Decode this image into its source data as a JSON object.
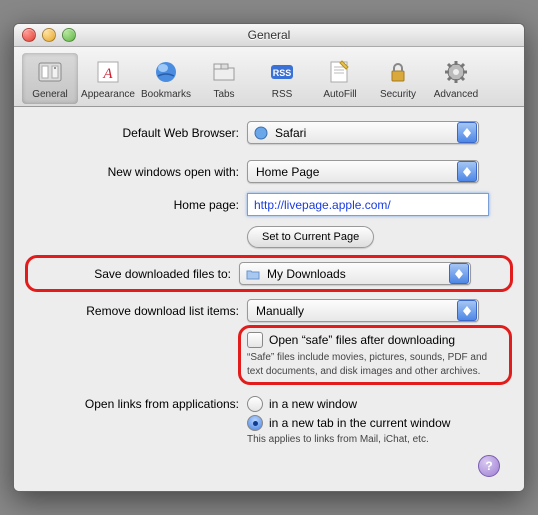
{
  "window_title": "General",
  "toolbar": {
    "items": [
      {
        "label": "General",
        "selected": true
      },
      {
        "label": "Appearance"
      },
      {
        "label": "Bookmarks"
      },
      {
        "label": "Tabs"
      },
      {
        "label": "RSS"
      },
      {
        "label": "AutoFill"
      },
      {
        "label": "Security"
      },
      {
        "label": "Advanced"
      }
    ]
  },
  "labels": {
    "default_browser": "Default Web Browser:",
    "new_windows": "New windows open with:",
    "home_page": "Home page:",
    "set_current": "Set to Current Page",
    "save_to": "Save downloaded files to:",
    "remove_list": "Remove download list items:",
    "open_safe": "Open “safe” files after downloading",
    "safe_desc": "“Safe” files include movies, pictures, sounds, PDF and text documents, and disk images and other archives.",
    "links_from": "Open links from applications:",
    "links_opt1": "in a new window",
    "links_opt2": "in a new tab in the current window",
    "links_note": "This applies to links from Mail, iChat, etc."
  },
  "values": {
    "default_browser": "Safari",
    "new_windows": "Home Page",
    "home_page": "http://livepage.apple.com/",
    "save_to": "My Downloads",
    "remove_list": "Manually"
  },
  "help_glyph": "?"
}
